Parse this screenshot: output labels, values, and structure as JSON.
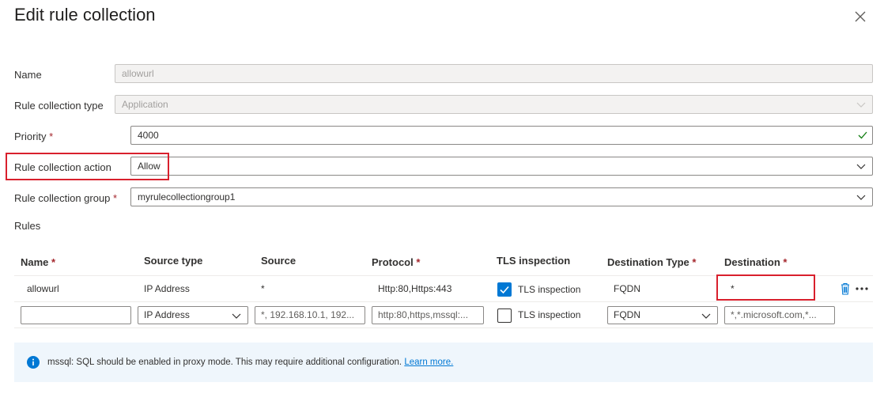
{
  "panel": {
    "title": "Edit rule collection"
  },
  "form": {
    "name_label": "Name",
    "name_value": "allowurl",
    "type_label": "Rule collection type",
    "type_value": "Application",
    "priority_label": "Priority",
    "priority_value": "4000",
    "action_label": "Rule collection action",
    "action_value": "Allow",
    "group_label": "Rule collection group",
    "group_value": "myrulecollectiongroup1",
    "required_mark": "*"
  },
  "rules": {
    "section_label": "Rules",
    "columns": {
      "name": "Name",
      "source_type": "Source type",
      "source": "Source",
      "protocol": "Protocol",
      "tls": "TLS inspection",
      "dest_type": "Destination Type",
      "destination": "Destination"
    },
    "row1": {
      "name": "allowurl",
      "source_type": "IP Address",
      "source": "*",
      "protocol": "Http:80,Https:443",
      "tls_checked": true,
      "tls_label": "TLS inspection",
      "dest_type": "FQDN",
      "destination": "*"
    },
    "new_row": {
      "name_value": "",
      "source_type": "IP Address",
      "source_placeholder": "*, 192.168.10.1, 192...",
      "protocol_placeholder": "http:80,https,mssql:...",
      "tls_checked": false,
      "tls_label": "TLS inspection",
      "dest_type": "FQDN",
      "destination_placeholder": "*,*.microsoft.com,*..."
    }
  },
  "info_bar": {
    "message": "mssql: SQL should be enabled in proxy mode. This may require additional configuration.",
    "link": "Learn more."
  },
  "colors": {
    "accent": "#0078d4",
    "highlight": "#d9202d",
    "success": "#107c10"
  }
}
